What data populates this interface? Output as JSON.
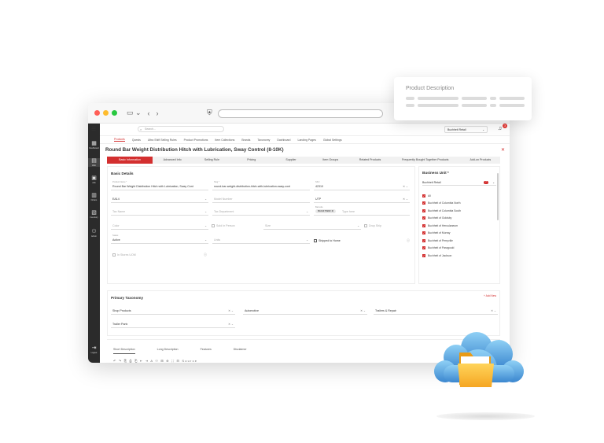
{
  "nav": {
    "items": [
      {
        "label": "Dashboard",
        "icon": "dashboard-icon"
      },
      {
        "label": "Web",
        "icon": "web-icon"
      },
      {
        "label": "Ads",
        "icon": "ads-icon"
      },
      {
        "label": "Orders",
        "icon": "orders-icon"
      },
      {
        "label": "Inventory",
        "icon": "inventory-icon"
      },
      {
        "label": "Admin",
        "icon": "admin-icon"
      },
      {
        "label": "Logout",
        "icon": "logout-icon"
      }
    ]
  },
  "topbar": {
    "search_placeholder": "Search...",
    "store": "Buchheit Retail",
    "notifications": "3"
  },
  "tabs": [
    "Products",
    "Quests",
    "Ultra Shift Selling Rules",
    "Product Promotions",
    "Item Collections",
    "Brands",
    "Taxonomy",
    "Dashboard",
    "Landing Pages",
    "Global Settings"
  ],
  "page_title": "Round Bar Weight Distribution Hitch with Lubrication, Sway Control (8-10K)",
  "steps": [
    "Basic Information",
    "Advanced Info",
    "Selling Rule",
    "Pricing",
    "Supplier",
    "Item Groups",
    "Related Products",
    "Frequently Bought Together Products",
    "Add-on Products"
  ],
  "basic": {
    "title": "Basic Details",
    "product_name_label": "Product Name *",
    "product_name": "Round Bar Weight Distribution Hitch with Lubrication, Sway Cont",
    "slug_label": "Slug *",
    "slug": "round-bar-weight-distribution-hitch-with-lubrication-sway-cont",
    "sku_label": "SKU",
    "sku": "42310",
    "uom": "EA14",
    "model_ph": "Model Number",
    "usage": "UTP",
    "tax_ph": "Tax Name",
    "tax_group_ph": "Tax Department",
    "barcode_label": "Barcode",
    "barcode_chip": "8023476982",
    "barcode_ph": "Type here",
    "color_ph": "Color",
    "size_ph": "Size",
    "sold_in_person": "Sold In Person",
    "drop_ship": "Drop Ship",
    "status_label": "Status",
    "status": "Active",
    "unit_ph": "Units",
    "shipped_home": "Shipped to Home",
    "lists_ph": "In Stores UOM"
  },
  "business_unit": {
    "title": "Business Unit *",
    "selected": "Buchheit Retail",
    "count": "7",
    "items": [
      "All",
      "Buchheit of Columbia North",
      "Buchheit of Columbia South",
      "Buchheit of Goldsby",
      "Buchheit of Herculaneum",
      "Buchheit of Murray",
      "Buchheit of Perryville",
      "Buchheit of Paragould",
      "Buchheit of Jackson"
    ]
  },
  "taxonomy": {
    "title": "Primary Taxonomy",
    "add_new": "+ Add New",
    "f1": "Shop Products",
    "f2": "Automotive",
    "f3": "Trailers & Repair",
    "f4": "Trailer Parts"
  },
  "desc_tabs": [
    "Short Description",
    "Long Description",
    "Features",
    "Disclaimer"
  ],
  "toolbar": "↶ ↷ ⎘ ⎙ ⎗ ⇤ ⇥ A ⚇ ⊞ ⊕ ⛶ ⊟ Source",
  "card_title": "Product Description",
  "colors": {
    "accent": "#d32f2f",
    "sidebar": "#2b2b2b",
    "cloud_light": "#7ec4ee",
    "cloud_dark": "#3f8fd2",
    "folder": "#f7b32b"
  }
}
